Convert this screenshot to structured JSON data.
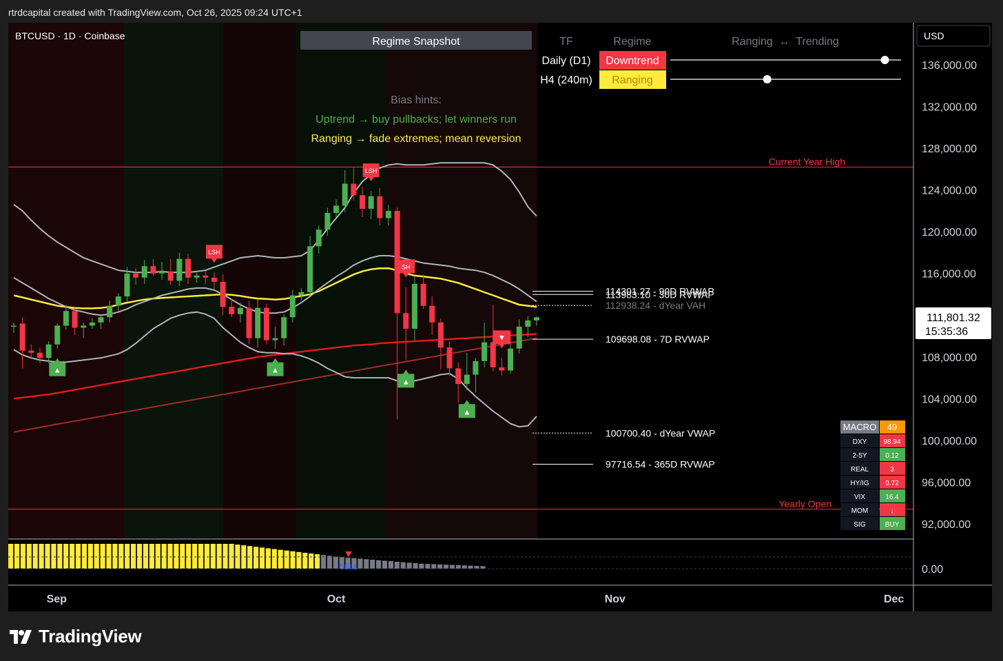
{
  "credit": "rtrdcapital created with TradingView.com, Oct 26, 2025 09:24 UTC+1",
  "symbol": "BTCUSD · 1D · Coinbase",
  "currency": "USD",
  "brand": "TradingView",
  "colors": {
    "up": "#4caf50",
    "down": "#f23645",
    "background": "#000000",
    "frame": "#1e1e1e",
    "ema_yellow": "#ffeb3b",
    "ma_red": "#e0191f",
    "bands": "#b2b5be",
    "level_line": "#f23645"
  },
  "regime": {
    "title": "Regime Snapshot",
    "col_tf": "TF",
    "col_regime": "Regime",
    "col_scale": "Ranging  ↔  Trending",
    "rows": [
      {
        "tf": "Daily (D1)",
        "regime": "Downtrend",
        "color": "#f23645",
        "level": 0.93
      },
      {
        "tf": "H4 (240m)",
        "regime": "Ranging",
        "color": "#ffeb3b",
        "level": 0.42
      }
    ]
  },
  "bias": {
    "title": "Bias hints:",
    "line1": "Uptrend → buy pullbacks; let winners run",
    "line2": "Ranging → fade extremes; mean reversion"
  },
  "macro": {
    "rows": [
      {
        "label": "MACRO",
        "value": "49",
        "color": "#ff9800"
      },
      {
        "label": "DXY",
        "value": "98.94",
        "color": "#f23645"
      },
      {
        "label": "2-5Y",
        "value": "0.12",
        "color": "#4caf50"
      },
      {
        "label": "REAL",
        "value": "3",
        "color": "#f23645"
      },
      {
        "label": "HY/IG",
        "value": "0.72",
        "color": "#f23645"
      },
      {
        "label": "VIX",
        "value": "16.4",
        "color": "#4caf50"
      },
      {
        "label": "MOM",
        "value": "↓",
        "color": "#f23645"
      },
      {
        "label": "SIG",
        "value": "BUY",
        "color": "#4caf50"
      }
    ]
  },
  "oscillator": {
    "zero_label": "0.00",
    "sell_label": "SELL",
    "values": [
      1,
      1,
      1,
      1,
      1,
      1,
      1,
      1,
      1,
      1,
      1,
      1,
      1,
      1,
      1,
      1,
      1,
      1,
      1,
      1,
      1,
      1,
      1,
      1,
      1,
      1,
      1,
      1,
      1,
      1,
      1,
      1,
      1,
      1,
      1,
      1,
      1,
      0.97,
      0.94,
      0.91,
      0.88,
      0.85,
      0.82,
      0.79,
      0.76,
      0.73,
      0.7,
      0.67,
      0.64,
      0.61,
      0.58,
      0.55,
      0.52,
      0.49,
      0.46,
      0.44,
      0.42,
      0.4,
      0.38,
      0.36,
      0.34,
      0.32,
      0.3,
      0.28,
      0.26,
      0.24,
      0.22,
      0.2,
      0.19,
      0.18,
      0.17,
      0.16,
      0.15,
      0.14,
      0.13,
      0.12,
      0.11,
      0.1
    ]
  },
  "chart_data": {
    "type": "candlestick",
    "ylim": [
      89000,
      138000
    ],
    "yticks": [
      "136,000.00",
      "132,000.00",
      "128,000.00",
      "124,000.00",
      "120,000.00",
      "116,000.00",
      "108,000.00",
      "104,000.00",
      "100,000.00",
      "96,000.00",
      "92,000.00"
    ],
    "ytick_values": [
      136000,
      132000,
      128000,
      124000,
      120000,
      116000,
      108000,
      104000,
      100000,
      96000,
      92000
    ],
    "xticks": [
      "Sep",
      "Oct",
      "Nov",
      "Dec"
    ],
    "xtick_index": [
      5,
      37,
      69,
      101
    ],
    "last_price": "111,801.32",
    "countdown": "15:35:36",
    "candles": [
      [
        110900,
        111300,
        110300,
        111000
      ],
      [
        111200,
        111800,
        106900,
        108600
      ],
      [
        108600,
        109200,
        107800,
        108400
      ],
      [
        108400,
        108900,
        107400,
        107900
      ],
      [
        107900,
        109500,
        107400,
        109200
      ],
      [
        109200,
        111200,
        108800,
        111000
      ],
      [
        111000,
        113000,
        110600,
        112400
      ],
      [
        112400,
        112700,
        110100,
        110800
      ],
      [
        110800,
        111300,
        109800,
        111000
      ],
      [
        111000,
        111700,
        110700,
        111300
      ],
      [
        111300,
        111900,
        110700,
        111800
      ],
      [
        111800,
        113400,
        111300,
        112900
      ],
      [
        112900,
        114100,
        112400,
        113800
      ],
      [
        113800,
        116600,
        113300,
        116000
      ],
      [
        116000,
        116500,
        114900,
        115600
      ],
      [
        115600,
        117300,
        115000,
        116700
      ],
      [
        116700,
        117400,
        115800,
        116000
      ],
      [
        116000,
        117100,
        115400,
        116200
      ],
      [
        116200,
        117400,
        114900,
        115300
      ],
      [
        115300,
        118000,
        114800,
        117400
      ],
      [
        117400,
        117900,
        115000,
        115600
      ],
      [
        115600,
        116100,
        115100,
        115800
      ],
      [
        115800,
        116300,
        115000,
        115600
      ],
      [
        115600,
        116100,
        114400,
        115200
      ],
      [
        115200,
        115900,
        112000,
        112800
      ],
      [
        112800,
        113600,
        111800,
        112100
      ],
      [
        112100,
        113200,
        111300,
        112700
      ],
      [
        112700,
        113400,
        109200,
        109800
      ],
      [
        109800,
        113500,
        108900,
        112700
      ],
      [
        112700,
        113100,
        109200,
        109600
      ],
      [
        109600,
        110900,
        108800,
        109800
      ],
      [
        109800,
        112100,
        109100,
        111800
      ],
      [
        111800,
        114400,
        111300,
        113900
      ],
      [
        113900,
        114600,
        113400,
        114200
      ],
      [
        114200,
        119600,
        113900,
        118600
      ],
      [
        118600,
        120600,
        117900,
        120200
      ],
      [
        120200,
        122300,
        119600,
        121800
      ],
      [
        121800,
        123100,
        121400,
        122500
      ],
      [
        122500,
        125900,
        121900,
        124600
      ],
      [
        124600,
        126200,
        123000,
        123500
      ],
      [
        123500,
        124300,
        121400,
        122200
      ],
      [
        122200,
        123900,
        121200,
        123400
      ],
      [
        123400,
        124200,
        120600,
        121300
      ],
      [
        121300,
        122600,
        120600,
        122000
      ],
      [
        122000,
        122300,
        102000,
        112200
      ],
      [
        112200,
        114700,
        107700,
        110700
      ],
      [
        110700,
        115800,
        109600,
        115000
      ],
      [
        115000,
        115900,
        112600,
        112900
      ],
      [
        112900,
        113800,
        110100,
        111300
      ],
      [
        111300,
        111700,
        106800,
        108900
      ],
      [
        108900,
        109500,
        106200,
        106900
      ],
      [
        106900,
        107500,
        103600,
        105400
      ],
      [
        105400,
        108400,
        104800,
        106300
      ],
      [
        106300,
        107900,
        104600,
        107600
      ],
      [
        107600,
        111300,
        107000,
        109400
      ],
      [
        109400,
        113000,
        106600,
        107000
      ],
      [
        107000,
        107900,
        106200,
        106700
      ],
      [
        106700,
        109300,
        106400,
        108800
      ],
      [
        108800,
        111600,
        108300,
        110900
      ],
      [
        110900,
        111900,
        109900,
        111500
      ],
      [
        111500,
        111900,
        111000,
        111800
      ]
    ],
    "levels": [
      {
        "label": "114301.27 - 90D RVWAP",
        "value": 114301.27,
        "style": "solid",
        "color": "#ffffff"
      },
      {
        "label": "113983.10 - 30D RVWAP",
        "value": 113983.1,
        "style": "solid",
        "color": "#ffffff"
      },
      {
        "label": "112938.24 - dYear VAH",
        "value": 112938.24,
        "style": "dotted",
        "color": "#ffffff"
      },
      {
        "label": "109698.08 - 7D RVWAP",
        "value": 109698.08,
        "style": "solid",
        "color": "#ffffff"
      },
      {
        "label": "100700.40 - dYear VWAP",
        "value": 100700.4,
        "style": "dotted",
        "color": "#ffffff"
      },
      {
        "label": "97716.54 - 365D RVWAP",
        "value": 97716.54,
        "style": "solid",
        "color": "#ffffff"
      }
    ],
    "horizontal_lines": [
      {
        "label": "Current Year High",
        "value": 126200
      },
      {
        "label": "Yearly Open",
        "value": 93400
      }
    ],
    "series": [
      {
        "name": "EMA",
        "color": "#ffeb3b",
        "values": [
          113900,
          113700,
          113500,
          113300,
          113100,
          112900,
          112800,
          112700,
          112650,
          112650,
          112700,
          112800,
          113000,
          113200,
          113350,
          113500,
          113600,
          113650,
          113700,
          113750,
          113800,
          113850,
          113900,
          113950,
          114000,
          113950,
          113850,
          113700,
          113600,
          113550,
          113500,
          113550,
          113700,
          113850,
          114000,
          114300,
          114700,
          115100,
          115500,
          115900,
          116200,
          116400,
          116500,
          116500,
          116300,
          116000,
          115800,
          115700,
          115600,
          115500,
          115300,
          115100,
          114800,
          114500,
          114200,
          113900,
          113600,
          113300,
          113000,
          112900,
          112800
        ]
      },
      {
        "name": "MA200",
        "color": "#e0191f",
        "values": [
          104000,
          104100,
          104200,
          104300,
          104400,
          104550,
          104700,
          104850,
          105000,
          105150,
          105300,
          105450,
          105600,
          105750,
          105900,
          106050,
          106200,
          106350,
          106500,
          106650,
          106800,
          106950,
          107100,
          107250,
          107400,
          107550,
          107700,
          107850,
          108000,
          108100,
          108200,
          108300,
          108400,
          108500,
          108600,
          108700,
          108800,
          108900,
          109000,
          109100,
          109150,
          109200,
          109300,
          109350,
          109400,
          109450,
          109500,
          109550,
          109600,
          109650,
          109700,
          109750,
          109800,
          109850,
          109900,
          109950,
          110000,
          110050,
          110100,
          110150,
          110200
        ]
      },
      {
        "name": "MA365",
        "color": "#a52a2a",
        "values": [
          100800,
          100950,
          101100,
          101250,
          101400,
          101550,
          101700,
          101850,
          102000,
          102150,
          102300,
          102450,
          102600,
          102750,
          102900,
          103050,
          103200,
          103350,
          103500,
          103650,
          103800,
          103950,
          104100,
          104250,
          104400,
          104550,
          104700,
          104850,
          105000,
          105150,
          105300,
          105450,
          105600,
          105750,
          105900,
          106050,
          106200,
          106350,
          106500,
          106650,
          106800,
          106950,
          107100,
          107250,
          107400,
          107550,
          107700,
          107850,
          108000,
          108150,
          108300,
          108450,
          108600,
          108750,
          108900,
          109050,
          109200,
          109350,
          109500,
          109650,
          109800
        ]
      },
      {
        "name": "BB Upper",
        "color": "#b2b5be",
        "values": [
          122600,
          122000,
          121100,
          120300,
          119600,
          119000,
          118500,
          118000,
          117500,
          117200,
          116900,
          116600,
          116300,
          116200,
          116100,
          116100,
          116100,
          116200,
          116100,
          116100,
          116100,
          116200,
          116300,
          116600,
          116900,
          117200,
          117500,
          117600,
          117700,
          117600,
          117500,
          117500,
          117600,
          117700,
          118200,
          119200,
          120300,
          121300,
          122300,
          123700,
          124800,
          125500,
          126100,
          126400,
          126500,
          126400,
          126400,
          126400,
          126500,
          126600,
          126600,
          126600,
          126600,
          126600,
          126600,
          126400,
          125800,
          125000,
          123800,
          122400,
          121500
        ]
      },
      {
        "name": "BB Mid",
        "color": "#b2b5be",
        "values": [
          115600,
          115100,
          114600,
          114100,
          113600,
          113200,
          112800,
          112500,
          112300,
          112100,
          112000,
          112100,
          112300,
          112600,
          113000,
          113300,
          113600,
          113900,
          114100,
          114300,
          114500,
          114600,
          114600,
          114400,
          114000,
          113500,
          113000,
          112600,
          112300,
          112200,
          112200,
          112300,
          112700,
          113200,
          113800,
          114500,
          115100,
          115700,
          116200,
          116800,
          117200,
          117500,
          117700,
          117700,
          117600,
          117400,
          117200,
          117000,
          116900,
          116800,
          116700,
          116500,
          116400,
          116300,
          116100,
          115800,
          115400,
          115000,
          114500,
          113900,
          113300
        ]
      },
      {
        "name": "BB Lower",
        "color": "#b2b5be",
        "values": [
          108700,
          108200,
          107900,
          107700,
          107600,
          107500,
          107500,
          107600,
          107700,
          107800,
          107900,
          108100,
          108300,
          108700,
          109300,
          110000,
          110700,
          111200,
          111700,
          112000,
          112200,
          112300,
          112100,
          111700,
          110800,
          110100,
          109400,
          108900,
          108500,
          108400,
          108400,
          108300,
          108300,
          108100,
          107800,
          107400,
          106900,
          106500,
          106100,
          106000,
          106000,
          106000,
          106000,
          106000,
          105700,
          105700,
          105700,
          105900,
          106100,
          106300,
          106400,
          105900,
          105000,
          104200,
          103500,
          102800,
          102200,
          101600,
          101300,
          101400,
          102300
        ]
      }
    ],
    "signals": [
      {
        "label": "▲",
        "index": 5,
        "kind": "buy"
      },
      {
        "label": "▲",
        "index": 30,
        "kind": "buy"
      },
      {
        "label": "▲",
        "index": 45,
        "kind": "buy"
      },
      {
        "label": "▲",
        "index": 52,
        "kind": "buy"
      },
      {
        "label": "▼",
        "index": 56,
        "kind": "sell"
      },
      {
        "label": "LSH",
        "index": 23,
        "kind": "sell"
      },
      {
        "label": "LSH",
        "index": 41,
        "kind": "sell"
      },
      {
        "label": "SH",
        "index": 45,
        "kind": "sell"
      }
    ]
  }
}
